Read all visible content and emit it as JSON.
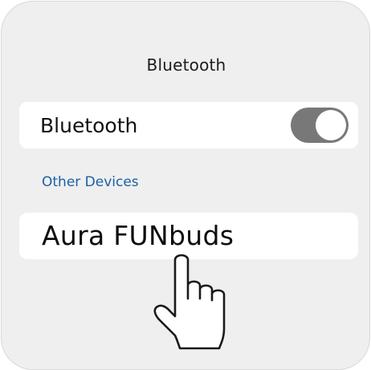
{
  "header": {
    "title": "Bluetooth"
  },
  "bluetooth": {
    "label": "Bluetooth",
    "enabled": true
  },
  "section": {
    "title": "Other Devices"
  },
  "devices": [
    {
      "name": "Aura FUNbuds"
    }
  ],
  "icons": {
    "pointer": "hand-pointer-icon"
  },
  "colors": {
    "background": "#efefef",
    "card": "#ffffff",
    "toggle_on": "#787878",
    "section_text": "#1b5fa8"
  }
}
